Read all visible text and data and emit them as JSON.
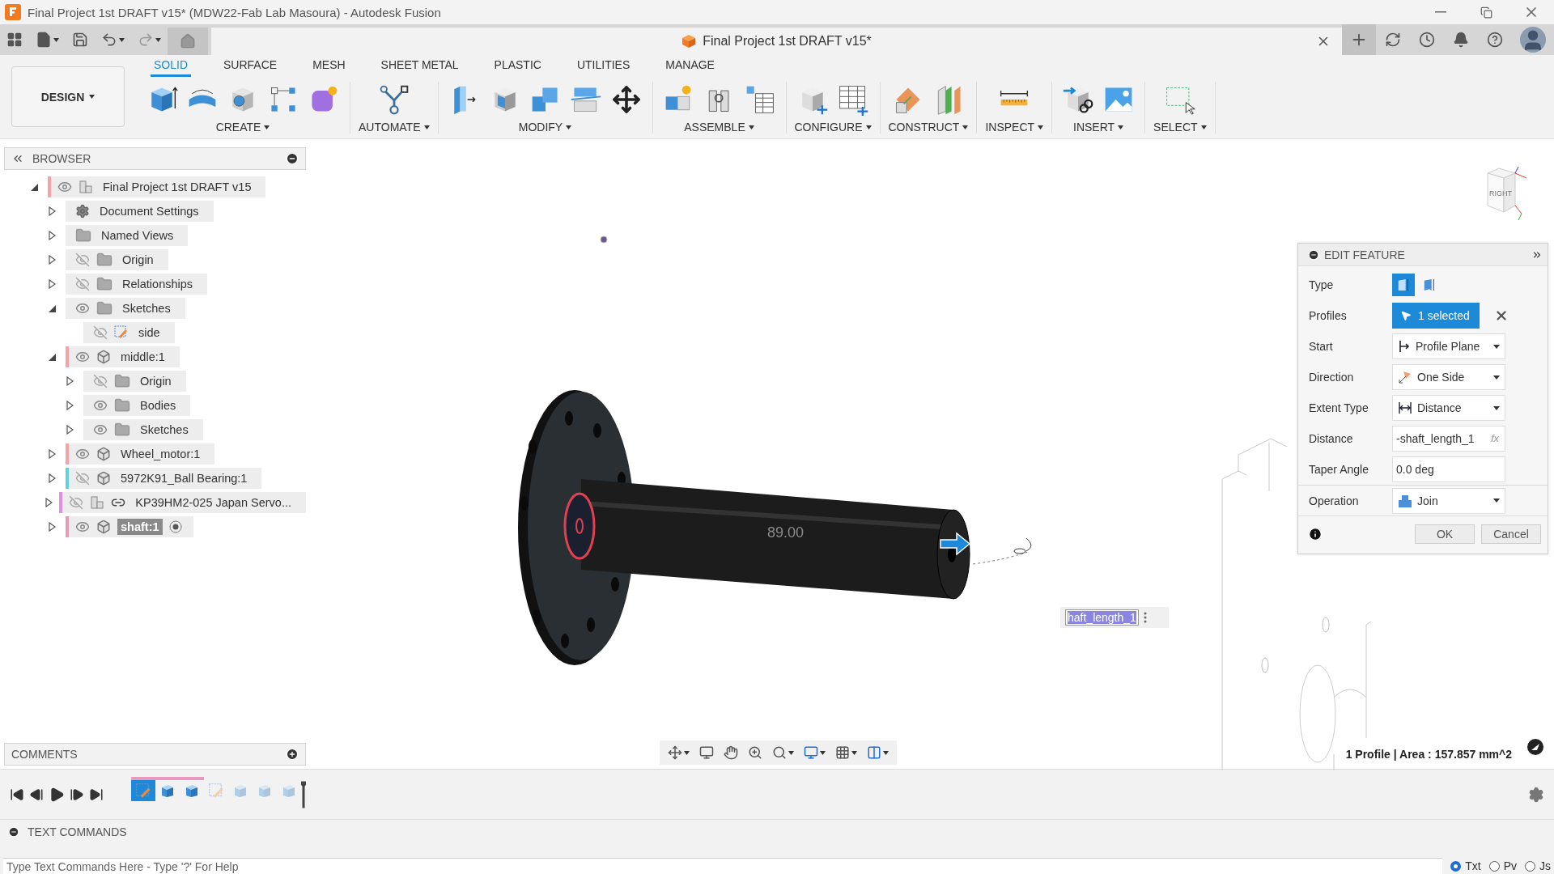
{
  "title_bar": {
    "title": "Final Project 1st DRAFT v15* (MDW22-Fab Lab Masoura) - Autodesk Fusion"
  },
  "document_tab": {
    "label": "Final Project 1st DRAFT v15*"
  },
  "ribbon": {
    "workspace": "DESIGN",
    "tabs": [
      {
        "label": "SOLID",
        "selected": true
      },
      {
        "label": "SURFACE",
        "selected": false
      },
      {
        "label": "MESH",
        "selected": false
      },
      {
        "label": "SHEET METAL",
        "selected": false
      },
      {
        "label": "PLASTIC",
        "selected": false
      },
      {
        "label": "UTILITIES",
        "selected": false
      },
      {
        "label": "MANAGE",
        "selected": false
      }
    ],
    "groups": [
      {
        "label": "CREATE"
      },
      {
        "label": "AUTOMATE"
      },
      {
        "label": "MODIFY"
      },
      {
        "label": "ASSEMBLE"
      },
      {
        "label": "CONFIGURE"
      },
      {
        "label": "CONSTRUCT"
      },
      {
        "label": "INSPECT"
      },
      {
        "label": "INSERT"
      },
      {
        "label": "SELECT"
      }
    ]
  },
  "browser": {
    "title": "BROWSER",
    "tree": [
      {
        "label": "Final Project 1st DRAFT v15",
        "kind": "design",
        "visible": true,
        "expanded": true,
        "selected": false,
        "color": "#f4a3a8",
        "children": [
          {
            "label": "Document Settings",
            "kind": "settings",
            "expanded": false,
            "selected": false
          },
          {
            "label": "Named Views",
            "kind": "folder",
            "expanded": false,
            "selected": false
          },
          {
            "label": "Origin",
            "kind": "folder",
            "visible": false,
            "expanded": false,
            "selected": false
          },
          {
            "label": "Relationships",
            "kind": "folder",
            "visible": false,
            "expanded": false,
            "selected": false
          },
          {
            "label": "Sketches",
            "kind": "folder",
            "visible": true,
            "expanded": true,
            "selected": false,
            "children": [
              {
                "label": "side",
                "kind": "sketch",
                "visible": false,
                "selected": false
              }
            ]
          },
          {
            "label": "middle:1",
            "kind": "component",
            "visible": true,
            "expanded": true,
            "selected": false,
            "color": "#f4a3a8",
            "children": [
              {
                "label": "Origin",
                "kind": "folder",
                "visible": false,
                "expanded": false,
                "selected": false
              },
              {
                "label": "Bodies",
                "kind": "folder",
                "visible": true,
                "expanded": false,
                "selected": false
              },
              {
                "label": "Sketches",
                "kind": "folder",
                "visible": true,
                "expanded": false,
                "selected": false
              }
            ]
          },
          {
            "label": "Wheel_motor:1",
            "kind": "component",
            "visible": true,
            "expanded": false,
            "selected": false,
            "color": "#f4a3a8"
          },
          {
            "label": "5972K91_Ball Bearing:1",
            "kind": "component",
            "visible": false,
            "expanded": false,
            "selected": false,
            "color": "#5fd3dc"
          },
          {
            "label": "KP39HM2-025 Japan Servo...",
            "kind": "linked-design",
            "visible": false,
            "expanded": false,
            "selected": false,
            "color": "#e08ee6"
          },
          {
            "label": "shaft:1",
            "kind": "component",
            "visible": true,
            "expanded": false,
            "selected": true,
            "color": "#e49ab8"
          }
        ]
      }
    ]
  },
  "comments": {
    "title": "COMMENTS"
  },
  "viewport": {
    "dimension_label": "89.00",
    "dimension_input": "haft_length_1",
    "viewcube_label": "RIGHT",
    "status": "1 Profile | Area : 157.857 mm^2"
  },
  "edit_feature": {
    "title": "EDIT FEATURE",
    "rows": [
      {
        "kind": "type",
        "label": "Type",
        "options": [
          {
            "selected": true
          },
          {
            "selected": false
          }
        ]
      },
      {
        "kind": "selection",
        "label": "Profiles",
        "value": "1 selected"
      },
      {
        "kind": "dropdown",
        "label": "Start",
        "value": "Profile Plane"
      },
      {
        "kind": "dropdown",
        "label": "Direction",
        "value": "One Side"
      },
      {
        "kind": "dropdown",
        "label": "Extent Type",
        "value": "Distance"
      },
      {
        "kind": "expression",
        "label": "Distance",
        "value": "-shaft_length_1",
        "suffix": "fx"
      },
      {
        "kind": "text",
        "label": "Taper Angle",
        "value": "0.0 deg"
      },
      {
        "kind": "dropdown",
        "label": "Operation",
        "value": "Join"
      }
    ],
    "buttons": [
      {
        "label": "OK"
      },
      {
        "label": "Cancel"
      }
    ]
  },
  "timeline": {
    "items": [
      {
        "kind": "sketch",
        "selected": true,
        "rolled_back": false,
        "grouped": true
      },
      {
        "kind": "extrude",
        "selected": false,
        "rolled_back": false,
        "grouped": true
      },
      {
        "kind": "extrude",
        "selected": false,
        "rolled_back": false,
        "grouped": true
      },
      {
        "kind": "sketch",
        "selected": false,
        "rolled_back": true,
        "grouped": false
      },
      {
        "kind": "extrude",
        "selected": false,
        "rolled_back": true,
        "grouped": false
      },
      {
        "kind": "extrude",
        "selected": false,
        "rolled_back": true,
        "grouped": false
      },
      {
        "kind": "extrude",
        "selected": false,
        "rolled_back": true,
        "grouped": false
      }
    ]
  },
  "text_commands": {
    "title": "TEXT COMMANDS",
    "placeholder": "Type Text Commands Here - Type '?' For Help",
    "modes": [
      {
        "label": "Txt",
        "selected": true
      },
      {
        "label": "Pv",
        "selected": false
      },
      {
        "label": "Js",
        "selected": false
      }
    ]
  }
}
